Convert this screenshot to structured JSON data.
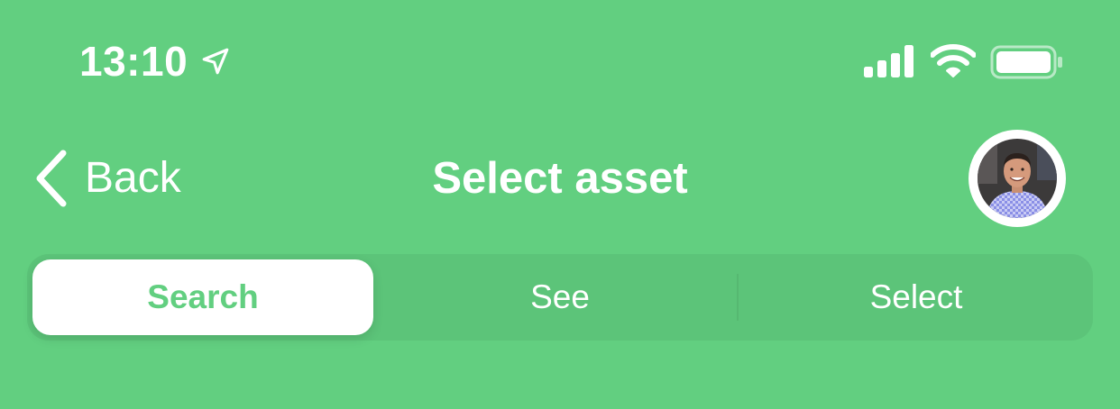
{
  "status_bar": {
    "time": "13:10",
    "icons": [
      "location-arrow-icon",
      "cellular-signal-icon",
      "wifi-icon",
      "battery-icon"
    ]
  },
  "nav": {
    "back_label": "Back",
    "title": "Select asset",
    "avatar_icon": "user-avatar"
  },
  "segments": {
    "items": [
      {
        "label": "Search",
        "selected": true
      },
      {
        "label": "See",
        "selected": false
      },
      {
        "label": "Select",
        "selected": false
      }
    ]
  },
  "colors": {
    "background": "#62cf80",
    "segment_track": "#5cc479",
    "selected_segment_bg": "#ffffff",
    "selected_segment_text": "#62cf80",
    "text": "#ffffff"
  }
}
